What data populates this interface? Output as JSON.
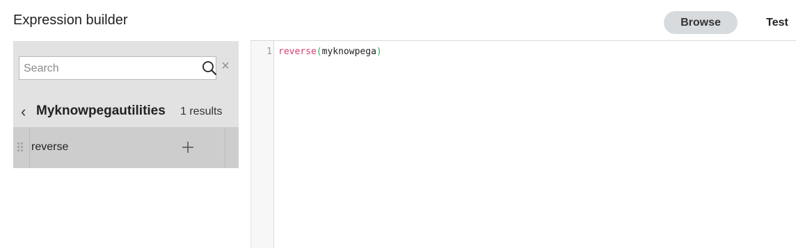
{
  "header": {
    "title": "Expression builder",
    "browse_label": "Browse",
    "test_label": "Test"
  },
  "sidebar": {
    "search": {
      "placeholder": "Search",
      "value": ""
    },
    "category": {
      "name": "Myknowpegautilities",
      "results": "1 results"
    },
    "items": [
      {
        "label": "reverse"
      }
    ]
  },
  "editor": {
    "line_number": "1",
    "tokens": {
      "function": "reverse",
      "open_paren": "(",
      "argument": "myknowpega",
      "close_paren": ")"
    }
  },
  "icons": {
    "search": "search-icon",
    "clear": "close-icon",
    "back": "chevron-left-icon",
    "drag": "drag-handle-icon",
    "add": "plus-icon"
  },
  "colors": {
    "browse_bg": "#d7dbdd",
    "panel_bg": "#e2e2e2",
    "row_bg": "#cdcdcd",
    "function_token": "#d53c6f",
    "paren_token": "#2fb35c"
  }
}
